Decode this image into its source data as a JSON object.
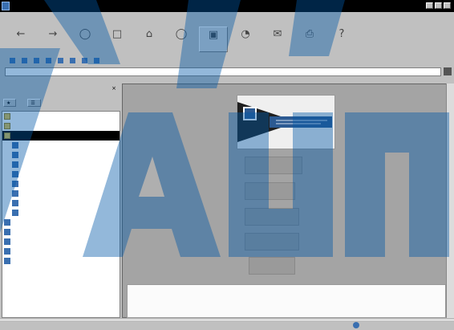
{
  "window": {
    "title": ""
  },
  "menu": [
    "",
    "",
    "",
    "",
    "",
    "",
    ""
  ],
  "toolbar": [
    {
      "label": "",
      "icon": "back-icon"
    },
    {
      "label": "",
      "icon": "forward-icon"
    },
    {
      "label": "",
      "icon": "stop-icon"
    },
    {
      "label": "",
      "icon": "refresh-icon"
    },
    {
      "label": "",
      "icon": "home-icon"
    },
    {
      "label": "",
      "icon": "search-icon"
    },
    {
      "label": "",
      "icon": "favorites-icon"
    },
    {
      "label": "",
      "icon": "history-icon"
    },
    {
      "label": "",
      "icon": "mail-icon"
    },
    {
      "label": "",
      "icon": "print-icon"
    },
    {
      "label": "",
      "icon": "discuss-icon"
    }
  ],
  "links": {
    "label": "",
    "items": [
      "",
      "",
      "",
      "",
      "",
      "",
      "",
      ""
    ]
  },
  "address": {
    "label": "",
    "value": ""
  },
  "favorites_panel": {
    "title": "",
    "add_button": "",
    "organize_button": "",
    "items": [
      {
        "label": "",
        "type": "folder",
        "indent": false,
        "selected": false
      },
      {
        "label": "",
        "type": "folder",
        "indent": false,
        "selected": false
      },
      {
        "label": "",
        "type": "folder",
        "indent": false,
        "selected": true
      },
      {
        "label": "",
        "type": "page",
        "indent": true,
        "selected": false
      },
      {
        "label": "",
        "type": "page",
        "indent": true,
        "selected": false
      },
      {
        "label": "",
        "type": "page",
        "indent": true,
        "selected": false
      },
      {
        "label": "",
        "type": "page",
        "indent": true,
        "selected": false
      },
      {
        "label": "",
        "type": "page",
        "indent": true,
        "selected": false
      },
      {
        "label": "",
        "type": "page",
        "indent": true,
        "selected": false
      },
      {
        "label": "",
        "type": "page",
        "indent": true,
        "selected": false
      },
      {
        "label": "",
        "type": "page",
        "indent": true,
        "selected": false
      },
      {
        "label": "",
        "type": "page",
        "indent": false,
        "selected": false
      },
      {
        "label": "",
        "type": "page",
        "indent": false,
        "selected": false
      },
      {
        "label": "",
        "type": "page",
        "indent": false,
        "selected": false
      },
      {
        "label": "",
        "type": "page",
        "indent": false,
        "selected": false
      },
      {
        "label": "",
        "type": "page",
        "indent": false,
        "selected": false
      }
    ]
  },
  "site": {
    "banner_letter": "",
    "nav_buttons": [
      "",
      "",
      "",
      "",
      ""
    ]
  },
  "infobox": {
    "lines": [
      "",
      "",
      ""
    ],
    "footer": ""
  },
  "status": {
    "text": "",
    "zone": ""
  },
  "watermark": "ГАУП"
}
